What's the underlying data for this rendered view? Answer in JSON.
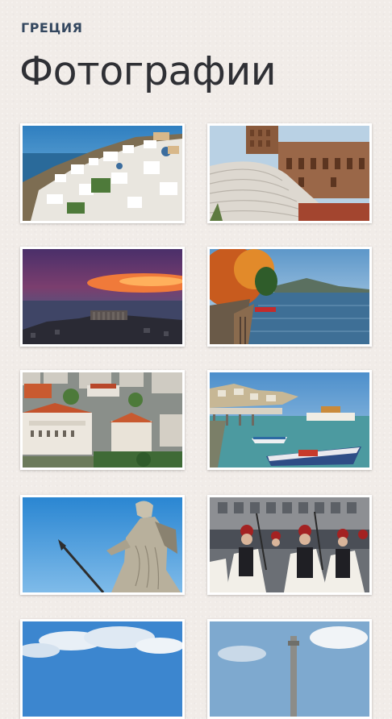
{
  "header": {
    "section": "ГРЕЦИЯ",
    "title": "Фотографии"
  },
  "photos": [
    {
      "subject": "santorini-village-photo"
    },
    {
      "subject": "ancient-theatre-photo"
    },
    {
      "subject": "acropolis-sunset-photo"
    },
    {
      "subject": "autumn-waterfront-photo"
    },
    {
      "subject": "city-aerial-photo"
    },
    {
      "subject": "harbor-boats-photo"
    },
    {
      "subject": "athena-statue-photo"
    },
    {
      "subject": "evzones-parade-photo"
    },
    {
      "subject": "clouds-sky-photo"
    },
    {
      "subject": "tower-sky-photo"
    }
  ]
}
